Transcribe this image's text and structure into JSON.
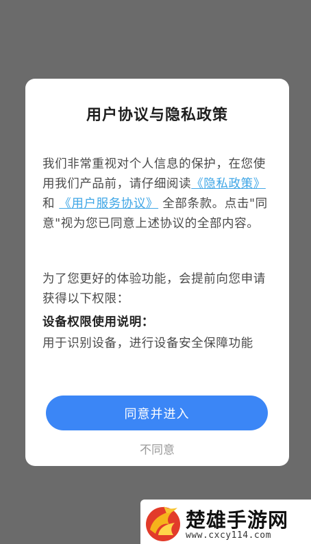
{
  "dialog": {
    "title": "用户协议与隐私政策",
    "intro_text_1": "我们非常重视对个人信息的保护，在您使用我们产品前，请仔细阅读",
    "privacy_link": "《隐私政策》",
    "and_text": "和",
    "service_link": "《用户服务协议》",
    "intro_text_2": "全部条款。点击\"同意\"视为您已同意上述协议的全部内容。",
    "permission_intro": "为了您更好的体验功能，会提前向您申请获得以下权限：",
    "permission_title": "设备权限使用说明：",
    "permission_desc": "用于识别设备，进行设备安全保障功能",
    "agree_label": "同意并进入",
    "disagree_label": "不同意"
  },
  "watermark": {
    "name": "楚雄手游网",
    "url": "www.cxcy114.com",
    "logo_icon": "flame-logo-icon"
  }
}
